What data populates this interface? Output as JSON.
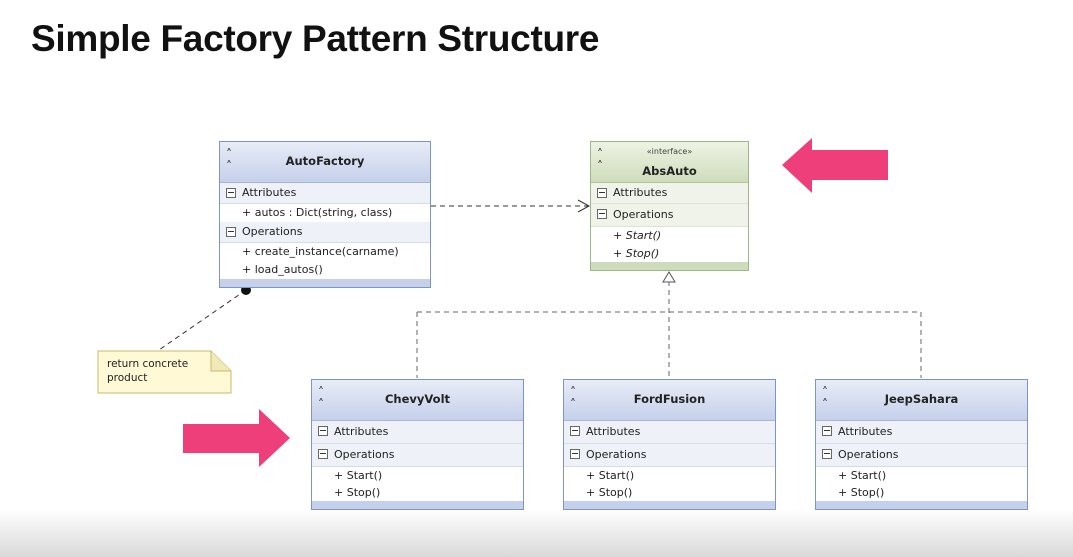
{
  "title": "Simple Factory Pattern Structure",
  "colors": {
    "accent_arrow": "#ef3f7a",
    "class_border": "#7f95c1",
    "interface_border": "#9fb58a",
    "note_fill": "#fff9d6"
  },
  "classes": {
    "autofactory": {
      "name": "AutoFactory",
      "attributes_label": "Attributes",
      "attributes": [
        "+ autos : Dict(string, class)"
      ],
      "operations_label": "Operations",
      "operations": [
        "+ create_instance(carname)",
        "+ load_autos()"
      ]
    },
    "absauto": {
      "stereotype": "«interface»",
      "name": "AbsAuto",
      "attributes_label": "Attributes",
      "operations_label": "Operations",
      "operations": [
        "+ Start()",
        "+ Stop()"
      ]
    },
    "chevyvolt": {
      "name": "ChevyVolt",
      "attributes_label": "Attributes",
      "operations_label": "Operations",
      "operations": [
        "+ Start()",
        "+ Stop()"
      ]
    },
    "fordfusion": {
      "name": "FordFusion",
      "attributes_label": "Attributes",
      "operations_label": "Operations",
      "operations": [
        "+ Start()",
        "+ Stop()"
      ]
    },
    "jeepsahara": {
      "name": "JeepSahara",
      "attributes_label": "Attributes",
      "operations_label": "Operations",
      "operations": [
        "+ Start()",
        "+ Stop()"
      ]
    }
  },
  "note": {
    "text": "return concrete product"
  },
  "icons": {
    "collapse": "chevron-double-up-icon",
    "section_toggle": "minus-box-icon",
    "highlight": "arrow-icon"
  }
}
